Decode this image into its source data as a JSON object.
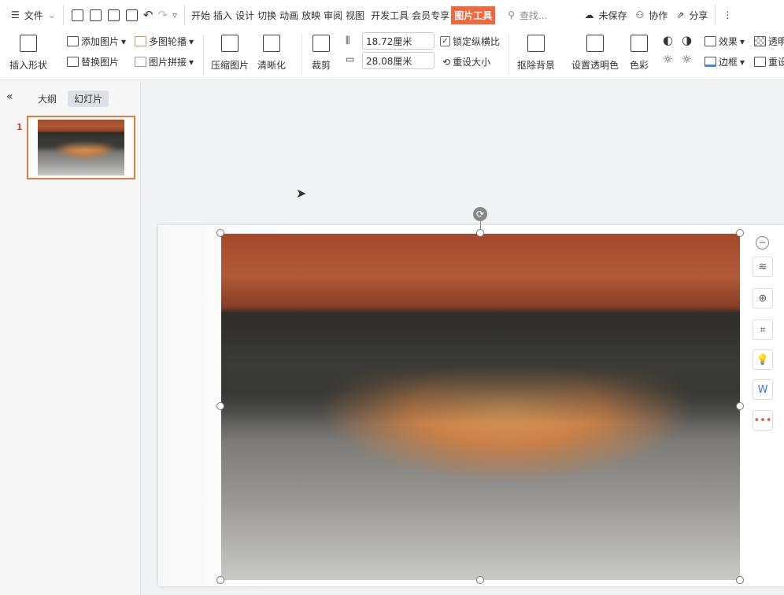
{
  "topbar": {
    "menu": "文件",
    "tabs": [
      "开始",
      "插入",
      "设计",
      "切换",
      "动画",
      "放映",
      "审阅",
      "视图",
      "开发工具",
      "会员专享",
      "图片工具"
    ],
    "active_tab": "图片工具",
    "search_placeholder": "查找...",
    "unsaved": "未保存",
    "collab": "协作",
    "share": "分享",
    "accent": "#f2683d"
  },
  "ribbon": {
    "insert_shape": "插入形状",
    "add_picture": "添加图片",
    "replace_picture": "替换图片",
    "carousel": "多图轮播",
    "collage": "图片拼接",
    "compress": "压缩图片",
    "sharpen": "清晰化",
    "crop": "裁剪",
    "height": "18.72厘米",
    "width": "28.08厘米",
    "lock_ratio": "锁定纵横比",
    "reset_size": "重设大小",
    "remove_bg": "抠除背景",
    "set_transparent": "设置透明色",
    "color": "色彩",
    "effects": "效果",
    "border": "边框",
    "transparency": "透明",
    "reset": "重设"
  },
  "panel": {
    "outline_tab": "大纲",
    "slides_tab": "幻灯片",
    "slide_number": "1"
  }
}
